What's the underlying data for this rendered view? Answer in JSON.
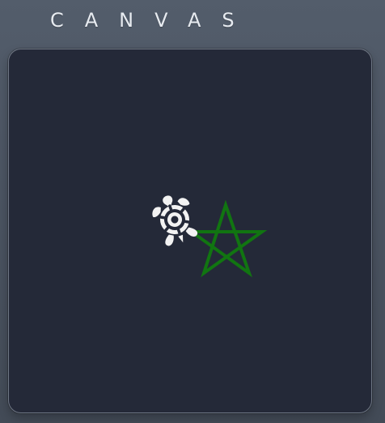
{
  "header": {
    "title": "CANVAS"
  },
  "canvas": {
    "background_color": "#242938",
    "border_color": "#6f7785",
    "turtle": {
      "icon": "turtle-icon",
      "color": "#f2f2f2"
    },
    "drawing": {
      "shape": "five-pointed star",
      "stroke_color": "#117511"
    }
  }
}
